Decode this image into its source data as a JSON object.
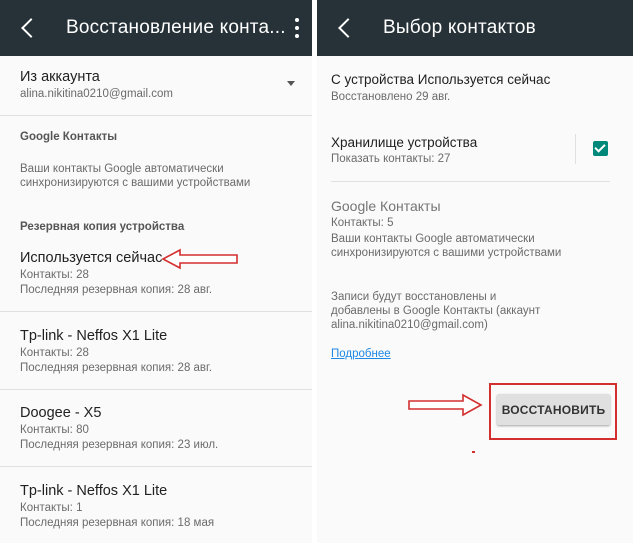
{
  "left": {
    "appbar_title": "Восстановление конта...",
    "account": {
      "title": "Из аккаунта",
      "email": "alina.nikitina0210@gmail.com"
    },
    "google_section": {
      "header": "Google Контакты",
      "desc_line1": "Ваши контакты Google автоматически",
      "desc_line2": "синхронизируются с вашими устройствами"
    },
    "backup_header": "Резервная копия устройства",
    "devices": [
      {
        "name": "Используется сейчас",
        "contacts": "Контакты: 28",
        "last_backup": "Последняя резервная копия: 28 авг."
      },
      {
        "name": "Tp-link - Neffos X1 Lite",
        "contacts": "Контакты: 28",
        "last_backup": "Последняя резервная копия: 28 авг."
      },
      {
        "name": "Doogee - X5",
        "contacts": "Контакты: 80",
        "last_backup": "Последняя резервная копия: 23 июл."
      },
      {
        "name": "Tp-link - Neffos X1 Lite",
        "contacts": "Контакты: 1",
        "last_backup": "Последняя резервная копия: 18 мая"
      }
    ]
  },
  "right": {
    "appbar_title": "Выбор контактов",
    "source": {
      "title": "С устройства Используется сейчас",
      "subtitle": "Восстановлено 29 авг."
    },
    "storage": {
      "title": "Хранилище устройства",
      "subtitle": "Показать контакты: 27",
      "checked": true
    },
    "google": {
      "title": "Google Контакты",
      "count": "Контакты: 5",
      "desc_line1": "Ваши контакты Google автоматически",
      "desc_line2": "синхронизируются с вашими устройствами"
    },
    "note": {
      "line1": "Записи будут восстановлены и",
      "line2": "добавлены в Google Контакты (аккаунт",
      "line3": "alina.nikitina0210@gmail.com)"
    },
    "more_link": "Подробнее",
    "restore_button": "ВОССТАНОВИТЬ"
  },
  "colors": {
    "appbar": "#263238",
    "checkbox": "#00897b",
    "annotation": "#d32f2f",
    "link": "#1e88e5"
  }
}
